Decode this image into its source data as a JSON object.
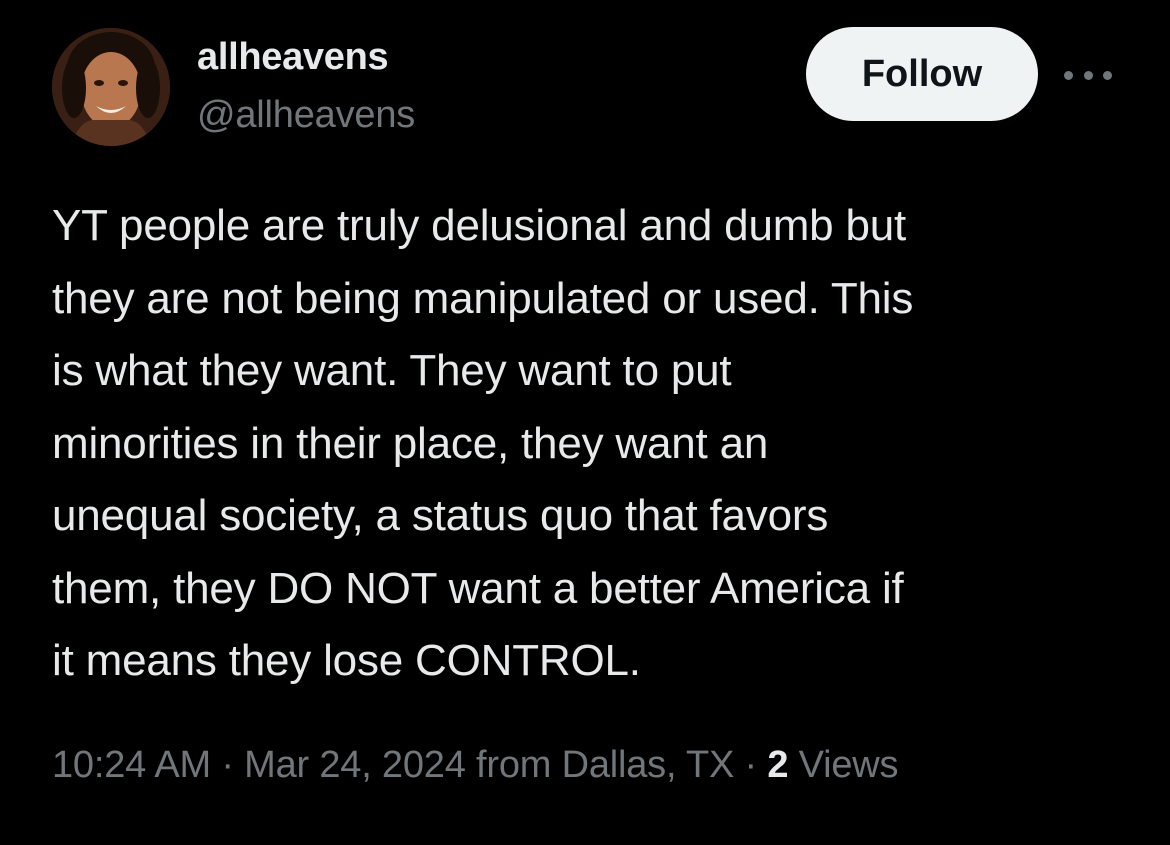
{
  "user": {
    "display_name": "allheavens",
    "handle": "@allheavens",
    "avatar_icon": "profile-photo"
  },
  "actions": {
    "follow_label": "Follow",
    "more_icon": "more-horizontal-icon"
  },
  "tweet": {
    "lines": [
      "YT people are truly delusional and dumb but",
      "they are not being manipulated or used. This",
      "is what they want. They want to put",
      "minorities in their place, they want an",
      "unequal society, a status quo that favors",
      "them, they DO NOT want a better America if",
      "it means they lose CONTROL."
    ]
  },
  "meta": {
    "time": "10:24 AM",
    "separator": " · ",
    "date": "Mar 24, 2024",
    "location": "from Dallas, TX",
    "views_count": "2",
    "views_label": " Views"
  },
  "colors": {
    "background": "#000000",
    "primary_text": "#e7e9ea",
    "secondary_text": "#71767b",
    "follow_bg": "#eff3f4",
    "follow_text": "#0f1419"
  }
}
